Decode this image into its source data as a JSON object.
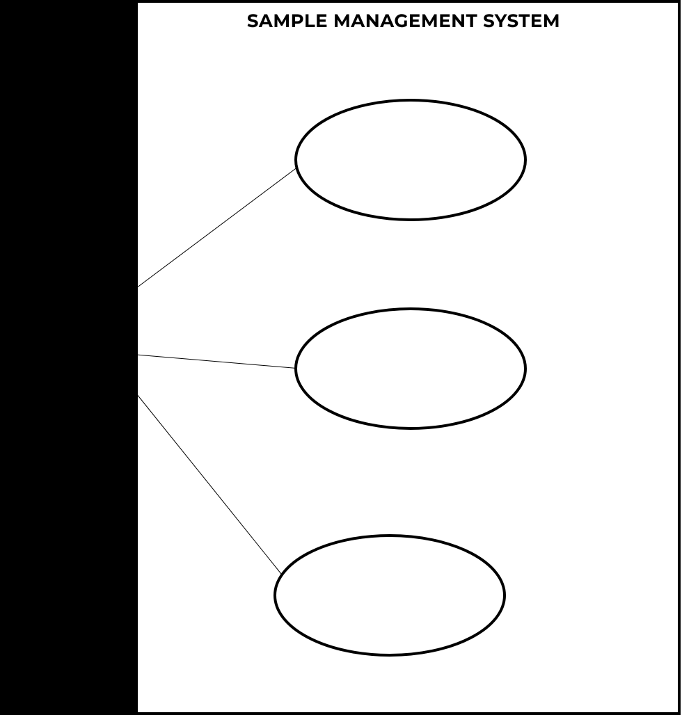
{
  "diagram": {
    "title": "SAMPLE MANAGEMENT SYSTEM",
    "actor_region": {
      "note": "solid black rectangle on left; no visible actor label"
    },
    "system_boundary": {
      "label": "SAMPLE MANAGEMENT SYSTEM"
    },
    "use_cases": [
      {
        "id": "uc1",
        "label": ""
      },
      {
        "id": "uc2",
        "label": ""
      },
      {
        "id": "uc3",
        "label": ""
      }
    ],
    "associations": [
      {
        "from": "actor",
        "to": "uc1"
      },
      {
        "from": "actor",
        "to": "uc2"
      },
      {
        "from": "actor",
        "to": "uc3"
      }
    ]
  }
}
